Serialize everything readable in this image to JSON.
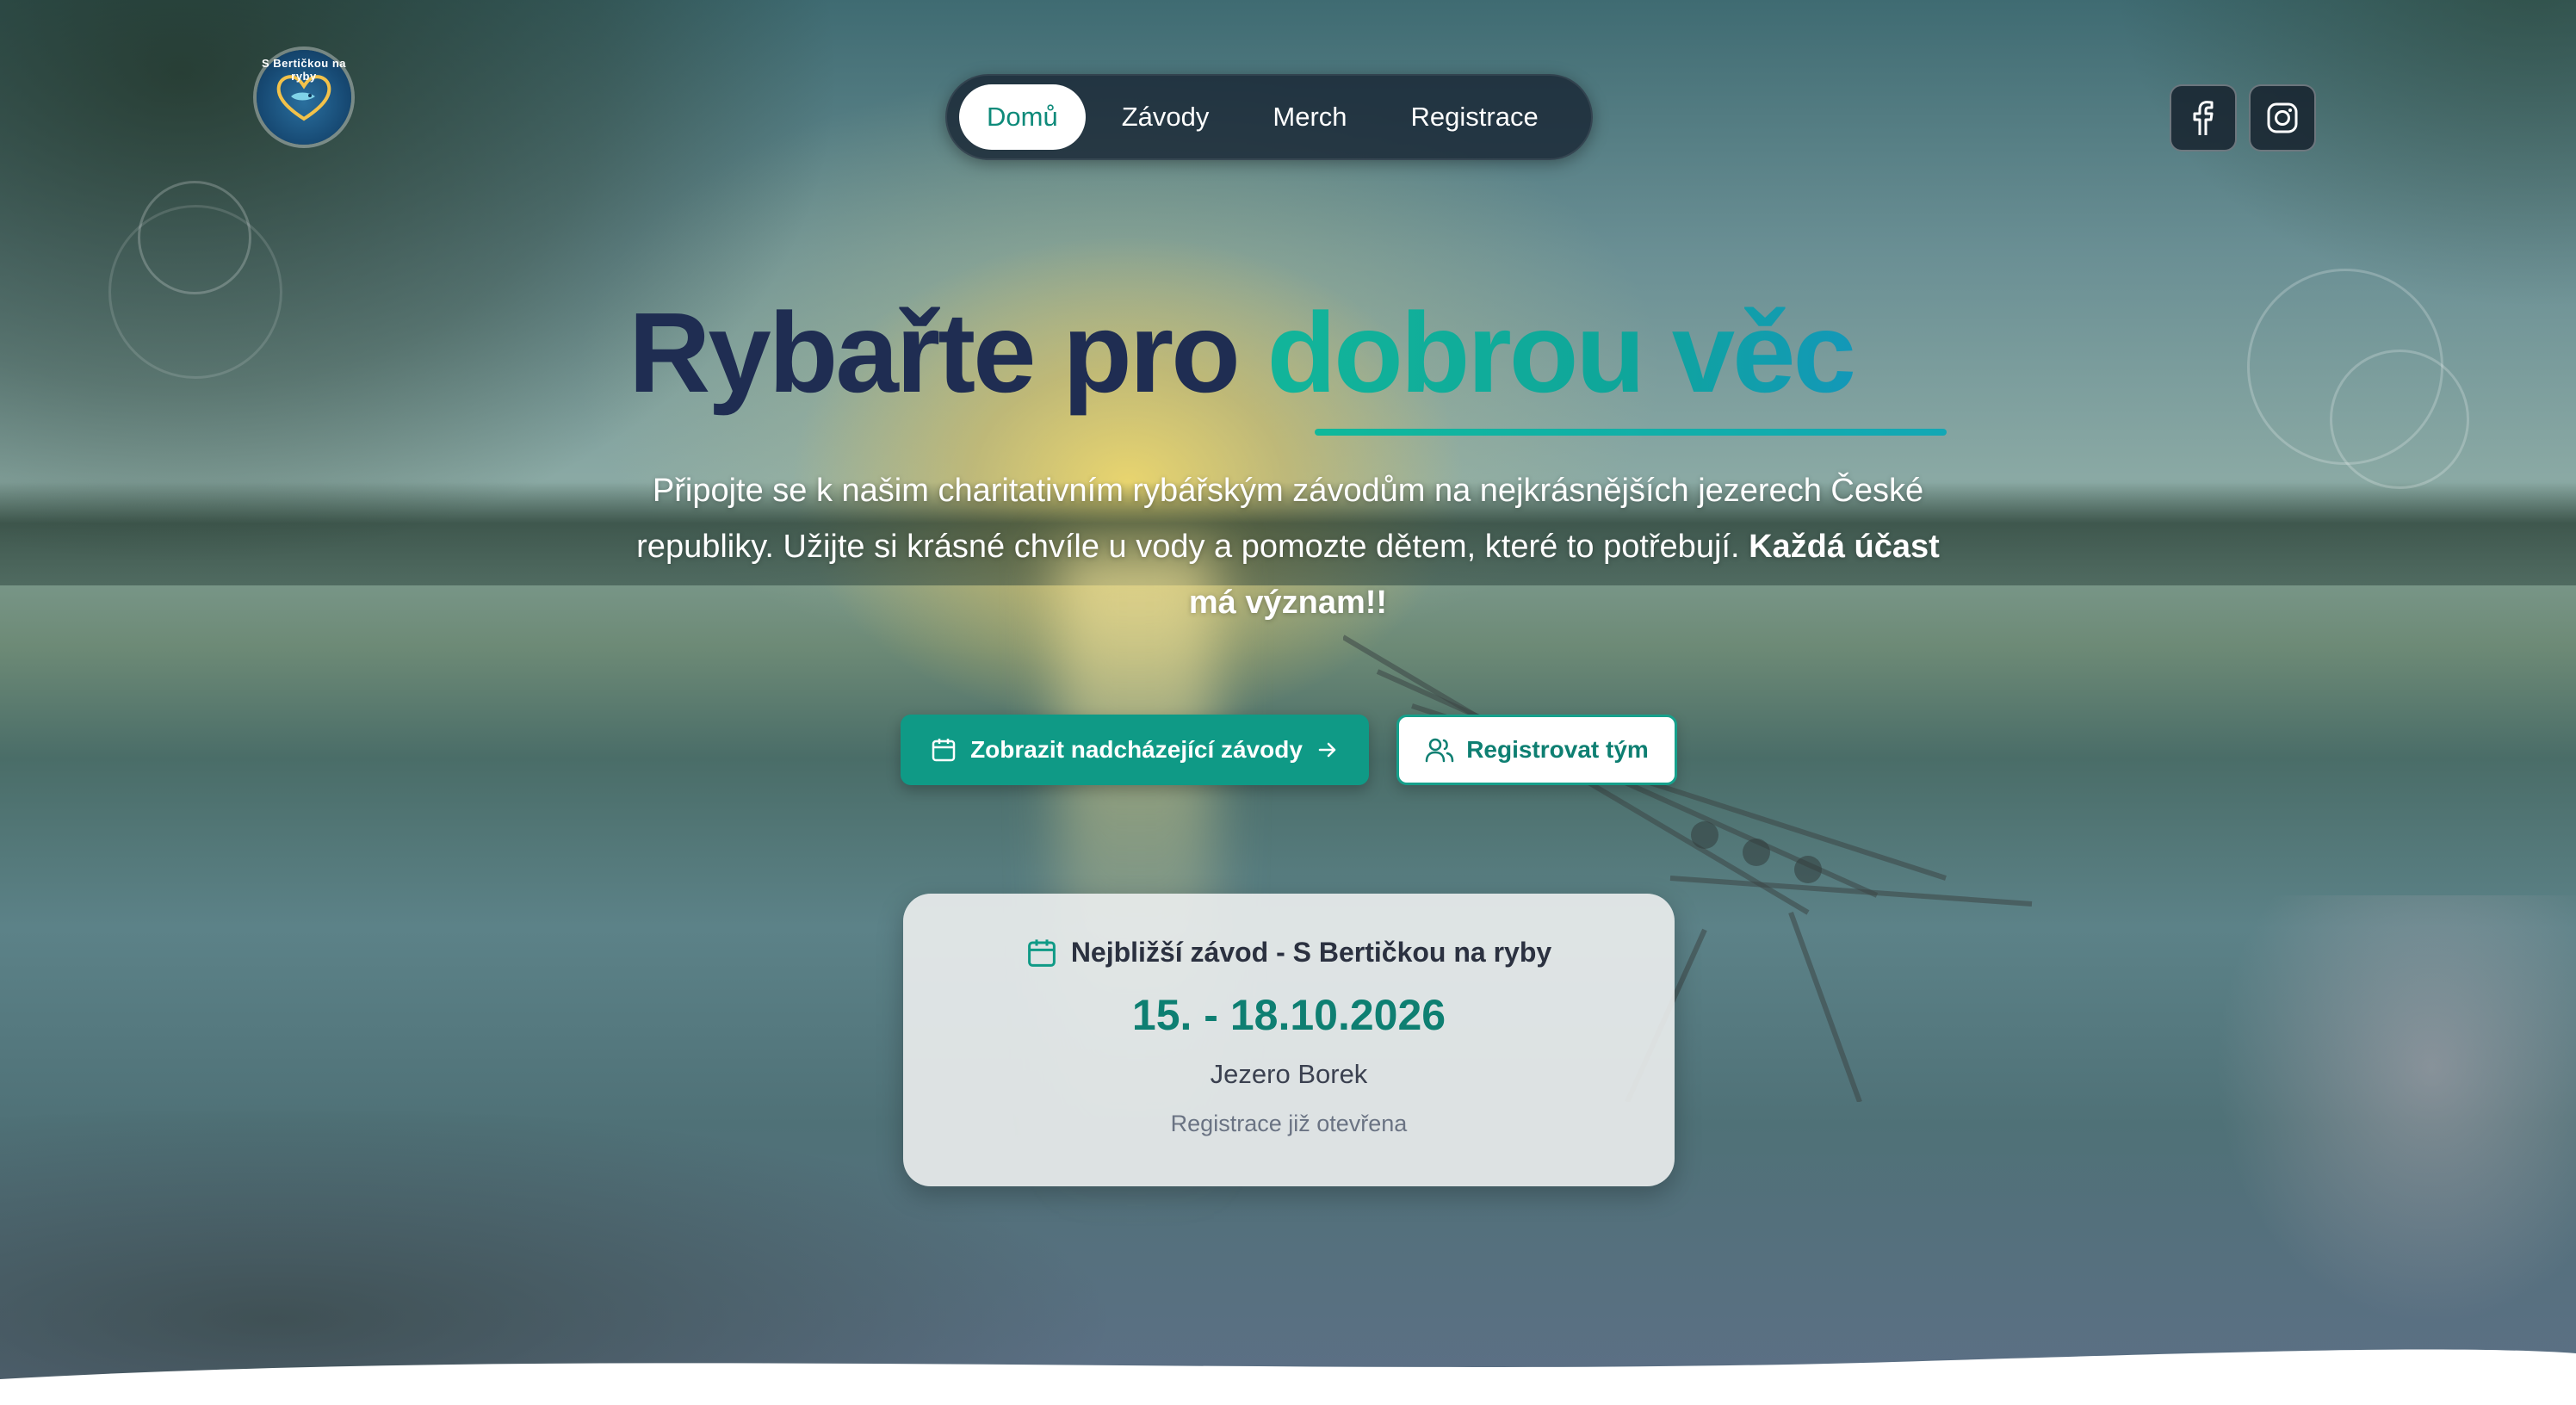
{
  "brand": {
    "logo_text": "S Bertičkou na ryby"
  },
  "nav": {
    "items": [
      {
        "label": "Domů",
        "active": true
      },
      {
        "label": "Závody",
        "active": false
      },
      {
        "label": "Merch",
        "active": false
      },
      {
        "label": "Registrace",
        "active": false
      }
    ]
  },
  "social": {
    "facebook_icon": "facebook-icon",
    "instagram_icon": "instagram-icon"
  },
  "hero": {
    "title_part1": "Rybařte pro",
    "title_accent": "dobrou věc",
    "text_part1": "Připojte se k našim charitativním rybářským závodům na nejkrásnějších jezerech České republiky. Užijte si krásné chvíle u vody a pomozte dětem, které to potřebují. ",
    "text_bold": "Každá účast má význam!!",
    "primary_button": "Zobrazit nadcházející závody",
    "secondary_button": "Registrovat tým"
  },
  "next_event": {
    "heading": "Nejbližší závod - S Bertičkou na ryby",
    "dates": "15. - 18.10.2026",
    "location": "Jezero Borek",
    "status": "Registrace již otevřena"
  },
  "colors": {
    "accent": "#0f9a86",
    "title_dark": "#1f2d52",
    "nav_bg": "#182634"
  }
}
